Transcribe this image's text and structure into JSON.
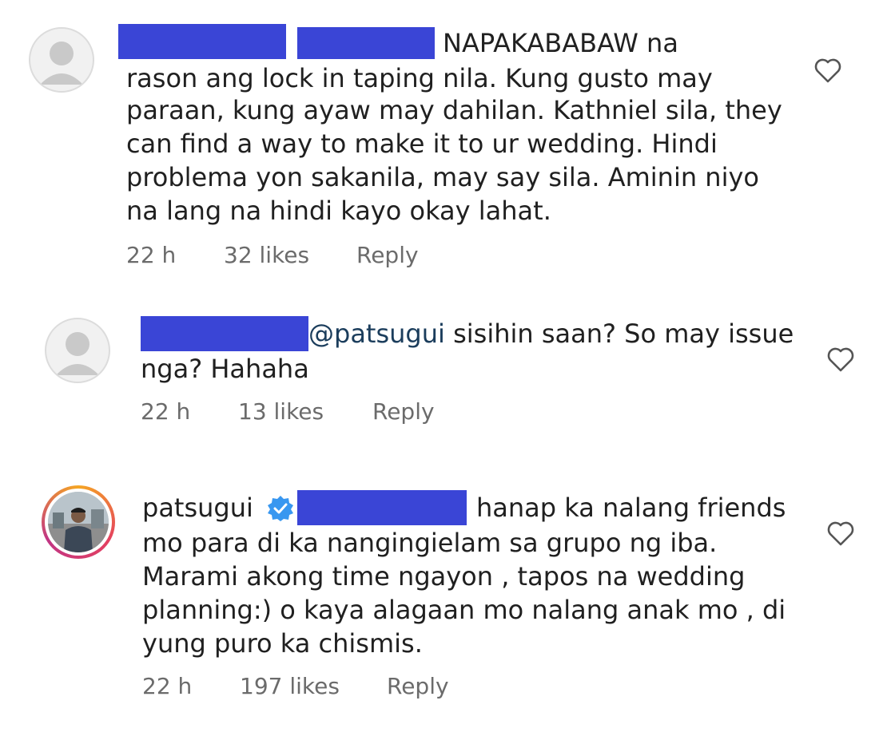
{
  "comments": [
    {
      "lines": [
        "NAPAKABABAW na",
        "rason ang lock in taping nila. Kung gusto may",
        "paraan, kung ayaw may dahilan. Kathniel sila, they",
        "can find a way to make it to ur wedding. Hindi",
        "problema yon sakanila, may say sila. Aminin niyo",
        "na lang na hindi kayo okay lahat."
      ],
      "time": "22 h",
      "likes": "32 likes",
      "reply": "Reply"
    },
    {
      "mention": "@patsugui",
      "lines": [
        " sisihin saan? So may issue",
        "nga? Hahaha"
      ],
      "time": "22 h",
      "likes": "13 likes",
      "reply": "Reply"
    },
    {
      "username": "patsugui",
      "lines": [
        "hanap ka nalang friends",
        "mo para di ka nangingielam sa grupo ng iba.",
        "Marami akong time ngayon , tapos na wedding",
        "planning:) o kaya alagaan mo nalang anak mo , di",
        "yung puro ka chismis."
      ],
      "time": "22 h",
      "likes": "197 likes",
      "reply": "Reply"
    }
  ],
  "colors": {
    "redaction": "#3a45d6",
    "meta_text": "#6b6b6b",
    "verified": "#3897f0"
  }
}
